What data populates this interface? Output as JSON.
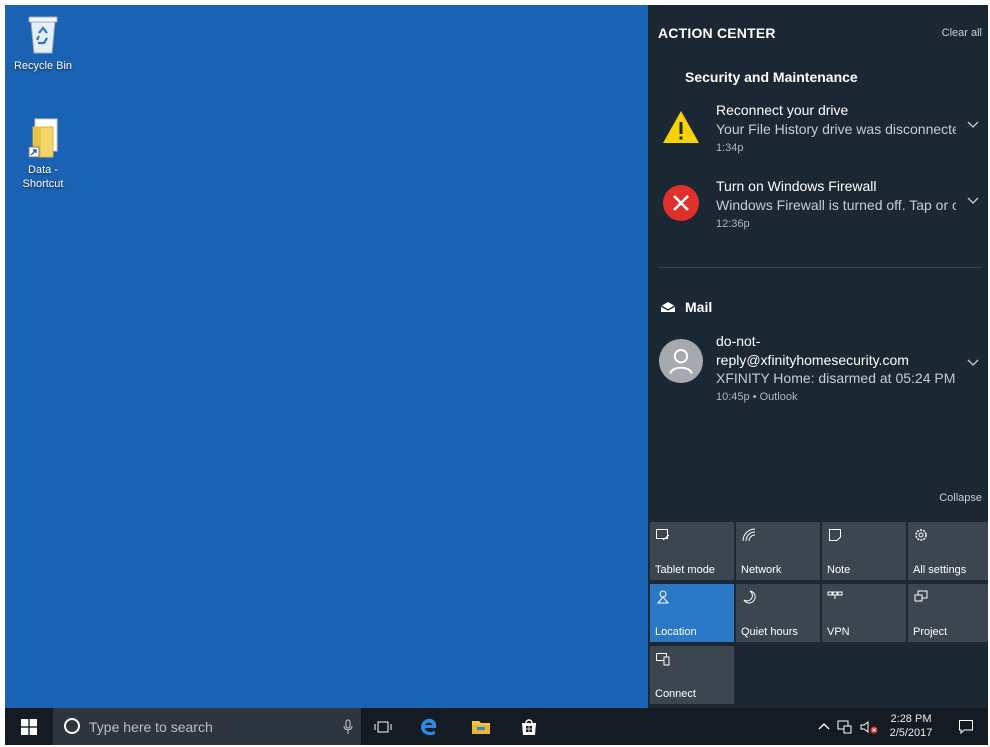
{
  "desktop": {
    "icons": [
      {
        "label": "Recycle Bin"
      },
      {
        "label": "Data -\nShortcut"
      }
    ]
  },
  "action_center": {
    "title": "ACTION CENTER",
    "clear_all": "Clear all",
    "groups": [
      {
        "title": "Security and Maintenance",
        "notifications": [
          {
            "title": "Reconnect your drive",
            "body": "Your File History drive was disconnected",
            "time": "1:34p",
            "icon": "warning-icon"
          },
          {
            "title": "Turn on Windows Firewall",
            "body": "Windows Firewall is turned off. Tap or click",
            "time": "12:36p",
            "icon": "error-icon"
          }
        ]
      },
      {
        "title": "Mail",
        "notifications": [
          {
            "title": "do-not-reply@xfinityhomesecurity.com",
            "title_line1": "do-not-",
            "title_line2": "reply@xfinityhomesecurity.com",
            "body": "XFINITY Home: disarmed at 05:24 PM",
            "time": "10:45p • Outlook",
            "icon": "avatar-icon"
          }
        ]
      }
    ],
    "collapse": "Collapse",
    "tiles": [
      {
        "label": "Tablet mode",
        "icon": "tablet-mode-icon",
        "active": false
      },
      {
        "label": "Network",
        "icon": "network-icon",
        "active": false
      },
      {
        "label": "Note",
        "icon": "note-icon",
        "active": false
      },
      {
        "label": "All settings",
        "icon": "settings-icon",
        "active": false
      },
      {
        "label": "Location",
        "icon": "location-icon",
        "active": true
      },
      {
        "label": "Quiet hours",
        "icon": "quiet-hours-icon",
        "active": false
      },
      {
        "label": "VPN",
        "icon": "vpn-icon",
        "active": false
      },
      {
        "label": "Project",
        "icon": "project-icon",
        "active": false
      },
      {
        "label": "Connect",
        "icon": "connect-icon",
        "active": false
      }
    ]
  },
  "taskbar": {
    "search_placeholder": "Type here to search",
    "clock_time": "2:28 PM",
    "clock_date": "2/5/2017"
  },
  "colors": {
    "desktop": "#1a62b3",
    "action_center": "#1c2734",
    "tile": "#3c4651",
    "tile_active": "#2a78c6",
    "taskbar": "#151b22"
  }
}
